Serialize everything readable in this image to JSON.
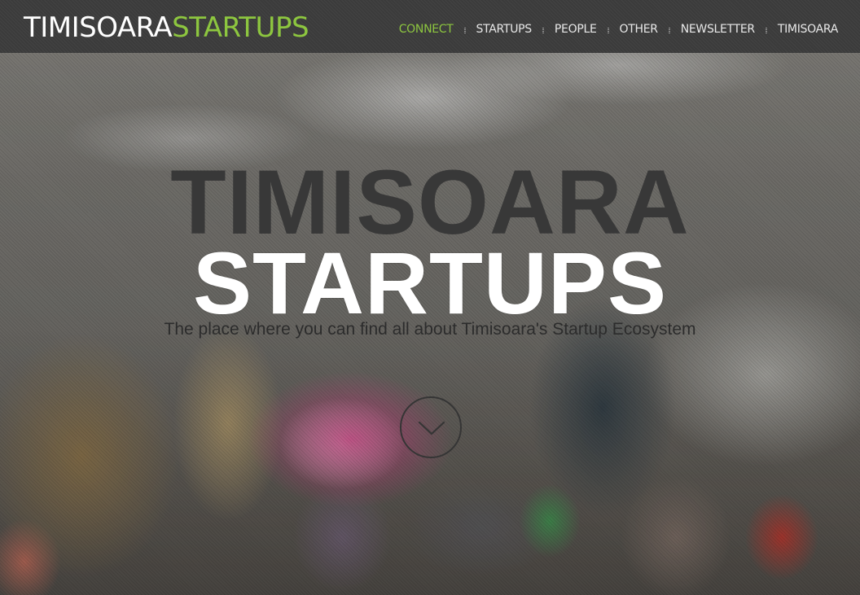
{
  "header": {
    "logo_part1": "TIMISOARA",
    "logo_part2": "STARTUPS",
    "nav": [
      {
        "label": "CONNECT",
        "active": true
      },
      {
        "label": "STARTUPS"
      },
      {
        "label": "PEOPLE"
      },
      {
        "label": "OTHER"
      },
      {
        "label": "NEWSLETTER"
      },
      {
        "label": "TIMISOARA"
      }
    ]
  },
  "hero": {
    "title_line1": "TIMISOARA",
    "title_line2": "STARTUPS",
    "tagline": "The place where you can find all about Timisoara's Startup Ecosystem",
    "scroll_icon": "chevron-down-icon"
  },
  "colors": {
    "accent_green": "#8dc63f",
    "topbar_bg": "#3b3b3b",
    "title_dark": "#383838",
    "title_light": "#ffffff"
  }
}
